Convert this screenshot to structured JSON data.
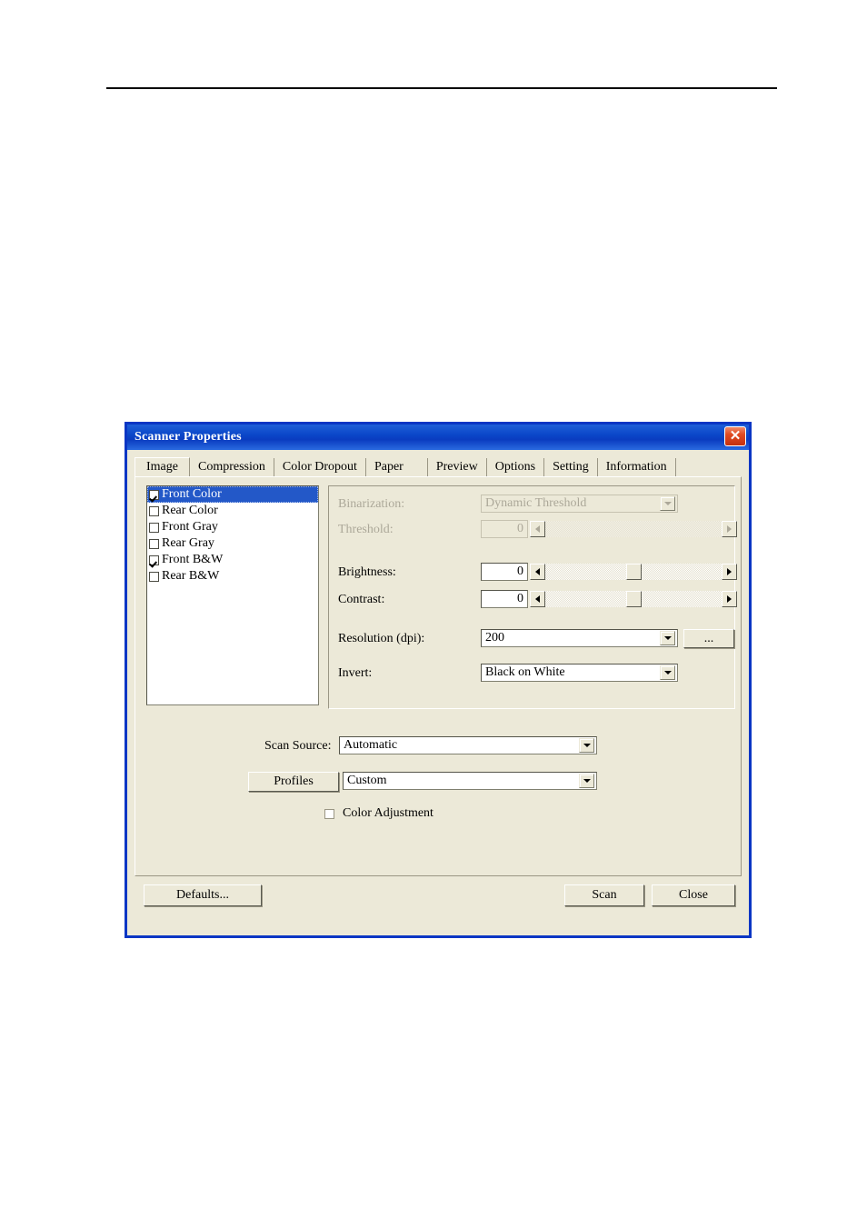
{
  "window": {
    "title": "Scanner Properties",
    "close_icon": "close-x-icon"
  },
  "tabs": [
    {
      "label": "Image",
      "selected": true
    },
    {
      "label": "Compression",
      "selected": false
    },
    {
      "label": "Color Dropout",
      "selected": false
    },
    {
      "label": "Paper",
      "selected": false
    },
    {
      "label": "Preview",
      "selected": false
    },
    {
      "label": "Options",
      "selected": false
    },
    {
      "label": "Setting",
      "selected": false
    },
    {
      "label": "Information",
      "selected": false
    }
  ],
  "image_selection": {
    "items": [
      {
        "label": "Front Color",
        "checked": true,
        "selected": true
      },
      {
        "label": "Rear Color",
        "checked": false,
        "selected": false
      },
      {
        "label": "Front Gray",
        "checked": false,
        "selected": false
      },
      {
        "label": "Rear Gray",
        "checked": false,
        "selected": false
      },
      {
        "label": "Front B&W",
        "checked": true,
        "selected": false
      },
      {
        "label": "Rear B&W",
        "checked": false,
        "selected": false
      }
    ]
  },
  "settings": {
    "binarization": {
      "label": "Binarization:",
      "value": "Dynamic Threshold",
      "disabled": true
    },
    "threshold": {
      "label": "Threshold:",
      "value": "0",
      "disabled": true,
      "thumb_percent": 0
    },
    "brightness": {
      "label": "Brightness:",
      "value": "0",
      "disabled": false,
      "thumb_percent": 50
    },
    "contrast": {
      "label": "Contrast:",
      "value": "0",
      "disabled": false,
      "thumb_percent": 50
    },
    "resolution": {
      "label": "Resolution (dpi):",
      "value": "200",
      "more_button": "..."
    },
    "invert": {
      "label": "Invert:",
      "value": "Black on White"
    }
  },
  "scan_source": {
    "label": "Scan Source:",
    "value": "Automatic"
  },
  "profiles": {
    "button_label": "Profiles",
    "value": "Custom"
  },
  "color_adjustment": {
    "label": "Color Adjustment",
    "checked": false
  },
  "buttons": {
    "defaults": "Defaults...",
    "scan": "Scan",
    "close": "Close"
  },
  "colors": {
    "title_bar": "#0a46c8",
    "dialog_face": "#ece9d8",
    "selection": "#2358c8",
    "disabled_text": "#aca899",
    "window_border": "#0a36c4"
  }
}
